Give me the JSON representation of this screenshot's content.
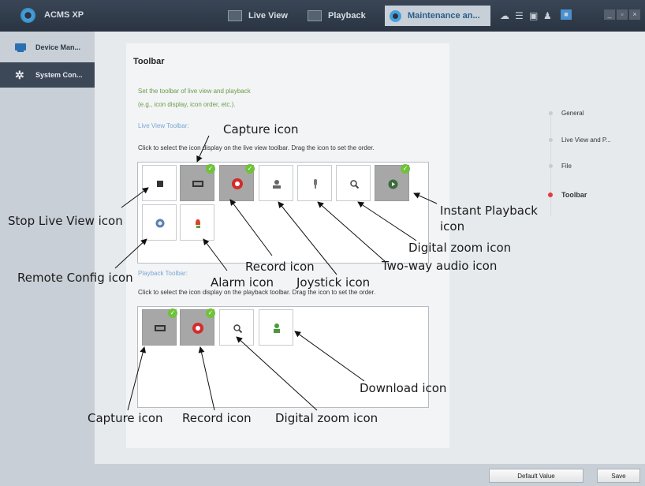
{
  "app": {
    "title": "ACMS XP"
  },
  "nav": {
    "tabs": [
      {
        "label": "Live View",
        "icon": "live-view-icon"
      },
      {
        "label": "Playback",
        "icon": "playback-icon"
      },
      {
        "label": "Maintenance an...",
        "icon": "maintenance-icon",
        "active": true
      }
    ],
    "tray_icons": [
      "cloud-icon",
      "menu-icon",
      "image-icon",
      "user-icon",
      "lock-icon"
    ],
    "window_buttons": [
      "_",
      "▫",
      "×"
    ]
  },
  "sidebar": {
    "items": [
      {
        "label": "Device Man...",
        "icon": "device-manager-icon",
        "active": false
      },
      {
        "label": "System Con...",
        "icon": "gear-icon",
        "active": true
      }
    ]
  },
  "content": {
    "heading": "Toolbar",
    "description_line1": "Set the toolbar of live view and playback",
    "description_line2": "(e.g., icon display, icon order, etc.).",
    "live_view_toolbar": {
      "title": "Live View Toolbar:",
      "instruction": "Click to select the icon display on the live view toolbar. Drag the icon to set the order."
    },
    "playback_toolbar": {
      "title": "Playback Toolbar:",
      "instruction": "Click to select the icon display on the playback toolbar. Drag the icon to set the order."
    }
  },
  "steps": [
    {
      "label": "General",
      "active": false
    },
    {
      "label": "Live View and P...",
      "active": false
    },
    {
      "label": "File",
      "active": false
    },
    {
      "label": "Toolbar",
      "active": true
    }
  ],
  "buttons": {
    "default_value": "Default Value",
    "save": "Save"
  },
  "callouts": {
    "capture_top": "Capture icon",
    "stop_live_view": "Stop Live View icon",
    "instant_playback_1": "Instant Playback",
    "instant_playback_2": "icon",
    "digital_zoom_top": "Digital zoom icon",
    "record_top": "Record icon",
    "two_way_audio": "Two-way audio icon",
    "remote_config": "Remote Config icon",
    "alarm": "Alarm icon",
    "joystick": "Joystick icon",
    "download": "Download icon",
    "capture_bottom": "Capture icon",
    "record_bottom": "Record icon",
    "digital_zoom_bottom": "Digital zoom icon"
  },
  "colors": {
    "check": "#6fc23a",
    "active_step": "#e23b3b",
    "description": "#6a9c4a",
    "link": "#7aa7d6"
  }
}
